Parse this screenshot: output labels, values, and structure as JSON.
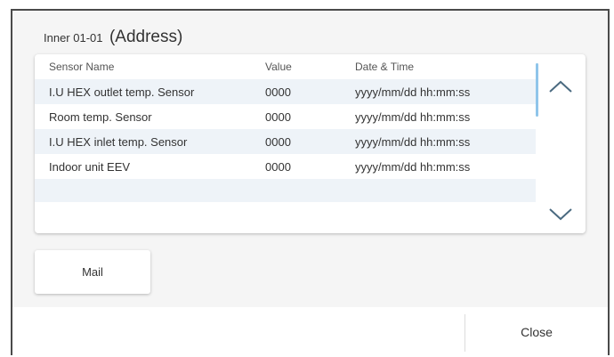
{
  "dialog": {
    "title_prefix": "Inner 01-01",
    "title_suffix": "(Address)"
  },
  "table": {
    "headers": {
      "name": "Sensor Name",
      "value": "Value",
      "datetime": "Date & Time"
    },
    "rows": [
      {
        "name": "I.U HEX outlet temp. Sensor",
        "value": "0000",
        "datetime": "yyyy/mm/dd hh:mm:ss"
      },
      {
        "name": "Room temp. Sensor",
        "value": "0000",
        "datetime": "yyyy/mm/dd hh:mm:ss"
      },
      {
        "name": "I.U HEX inlet temp. Sensor",
        "value": "0000",
        "datetime": "yyyy/mm/dd hh:mm:ss"
      },
      {
        "name": "Indoor unit EEV",
        "value": "0000",
        "datetime": "yyyy/mm/dd hh:mm:ss"
      }
    ]
  },
  "buttons": {
    "mail": "Mail",
    "close": "Close"
  },
  "icons": {
    "scroll_up": "chevron-up-icon",
    "scroll_down": "chevron-down-icon"
  },
  "colors": {
    "row_alt": "#eef3f8",
    "scrollbar": "#8fc5ea",
    "frame": "#4a4a4a"
  }
}
